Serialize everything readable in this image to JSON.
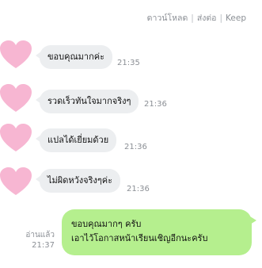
{
  "header": {
    "actions": [
      {
        "label": "ดาวน์โหลด"
      },
      {
        "label": "ส่งต่อ"
      },
      {
        "label": "Keep"
      }
    ],
    "separator": "|"
  },
  "messages_in": [
    {
      "text": "ขอบคุณมากค่ะ",
      "time": "21:35",
      "avatar": "pink-heart-avatar"
    },
    {
      "text": "รวดเร็วทันใจมากจริงๆ",
      "time": "21:36",
      "avatar": "pink-heart-avatar"
    },
    {
      "text": "แปลได้เยี่ยมด้วย",
      "time": "21:36",
      "avatar": "pink-heart-avatar"
    },
    {
      "text": "ไม่ผิดหวังจริงๆค่ะ",
      "time": "21:36",
      "avatar": "pink-heart-avatar"
    }
  ],
  "message_out": {
    "line1": "ขอบคุณมากๆ ครับ",
    "line2": "เอาไว้โอกาสหน้าเรียนเชิญอีกนะครับ",
    "read_label": "อ่านแล้ว",
    "time": "21:37"
  },
  "colors": {
    "incoming_bubble": "#eceef0",
    "outgoing_bubble": "#b5ef8e",
    "avatar_heart": "#f7b6d2",
    "meta_text": "#8b8f95"
  }
}
